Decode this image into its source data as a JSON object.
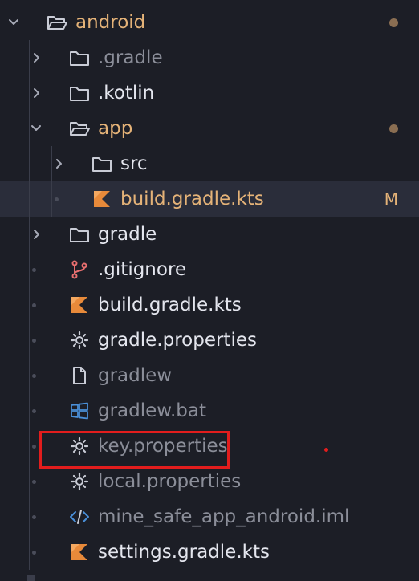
{
  "explorer": {
    "items": [
      {
        "label": "android",
        "icon": "folder-open-icon",
        "state": "expanded",
        "depth": 0,
        "status": "modified-dot"
      },
      {
        "label": ".gradle",
        "icon": "folder-icon",
        "state": "collapsed",
        "depth": 1,
        "dim": true
      },
      {
        "label": ".kotlin",
        "icon": "folder-icon",
        "state": "collapsed",
        "depth": 1
      },
      {
        "label": "app",
        "icon": "folder-open-icon",
        "state": "expanded",
        "depth": 1,
        "status": "modified-dot"
      },
      {
        "label": "src",
        "icon": "folder-icon",
        "state": "collapsed",
        "depth": 2
      },
      {
        "label": "build.gradle.kts",
        "icon": "kotlin-icon",
        "depth": 2,
        "selected": true,
        "badge": "M"
      },
      {
        "label": "gradle",
        "icon": "folder-icon",
        "state": "collapsed",
        "depth": 1
      },
      {
        "label": ".gitignore",
        "icon": "git-branch-icon",
        "depth": 1
      },
      {
        "label": "build.gradle.kts",
        "icon": "kotlin-icon",
        "depth": 1
      },
      {
        "label": "gradle.properties",
        "icon": "gear-icon",
        "depth": 1
      },
      {
        "label": "gradlew",
        "icon": "file-icon",
        "depth": 1,
        "dim": true
      },
      {
        "label": "gradlew.bat",
        "icon": "windows-icon",
        "depth": 1,
        "dim": true
      },
      {
        "label": "key.properties",
        "icon": "gear-icon",
        "depth": 1,
        "dim": true,
        "highlighted": true
      },
      {
        "label": "local.properties",
        "icon": "gear-icon",
        "depth": 1,
        "dim": true
      },
      {
        "label": "mine_safe_app_android.iml",
        "icon": "code-icon",
        "depth": 1,
        "dim": true
      },
      {
        "label": "settings.gradle.kts",
        "icon": "kotlin-icon",
        "depth": 1
      }
    ]
  },
  "colors": {
    "background": "#1c1e26",
    "text": "#e4e6ee",
    "modified_text": "#e5b378",
    "dim_text": "#8b8e99",
    "highlight_border": "#e21d1d",
    "kotlin_accent": "#e88a3a",
    "windows_accent": "#4a90d9"
  }
}
